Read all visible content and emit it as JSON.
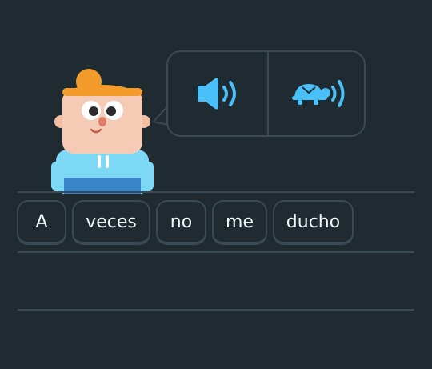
{
  "colors": {
    "background": "#1f2a31",
    "border": "#3a4a55",
    "accent_blue": "#49c0f8",
    "text": "#f1f7fb"
  },
  "audio": {
    "normal_icon": "speaker-icon",
    "slow_icon": "turtle-speaker-icon"
  },
  "word_bank": {
    "tiles": [
      "A",
      "veces",
      "no",
      "me",
      "ducho"
    ]
  }
}
